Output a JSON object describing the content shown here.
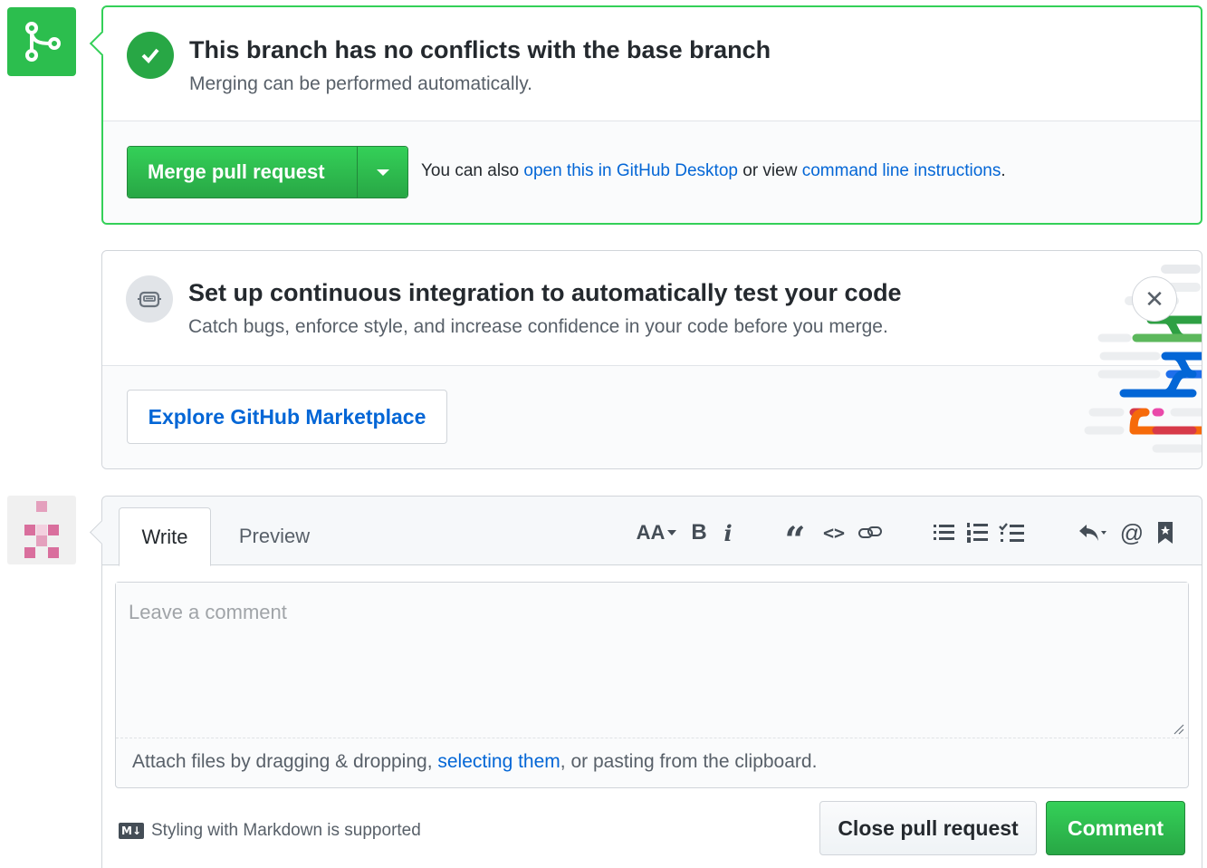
{
  "merge": {
    "title": "This branch has no conflicts with the base branch",
    "subtitle": "Merging can be performed automatically.",
    "button_label": "Merge pull request",
    "hint_prefix": "You can also ",
    "hint_link1": "open this in GitHub Desktop",
    "hint_middle": " or view ",
    "hint_link2": "command line instructions",
    "hint_suffix": ".",
    "accent_color": "#28a745",
    "icon": "git-merge-icon"
  },
  "ci": {
    "title": "Set up continuous integration to automatically test your code",
    "subtitle": "Catch bugs, enforce style, and increase confidence in your code before you merge.",
    "button_label": "Explore GitHub Marketplace",
    "close_label": "✕",
    "icon": "robot-icon"
  },
  "comment": {
    "tab_write": "Write",
    "tab_preview": "Preview",
    "placeholder": "Leave a comment",
    "attach_prefix": "Attach files by dragging & dropping, ",
    "attach_link": "selecting them",
    "attach_suffix": ", or pasting from the clipboard.",
    "markdown_badge": "M↓",
    "markdown_note": "Styling with Markdown is supported",
    "close_button": "Close pull request",
    "comment_button": "Comment",
    "toolbar": {
      "heading": "AA",
      "bold": "B",
      "italic": "i",
      "quote": "“",
      "code": "<>",
      "mention": "@"
    }
  }
}
